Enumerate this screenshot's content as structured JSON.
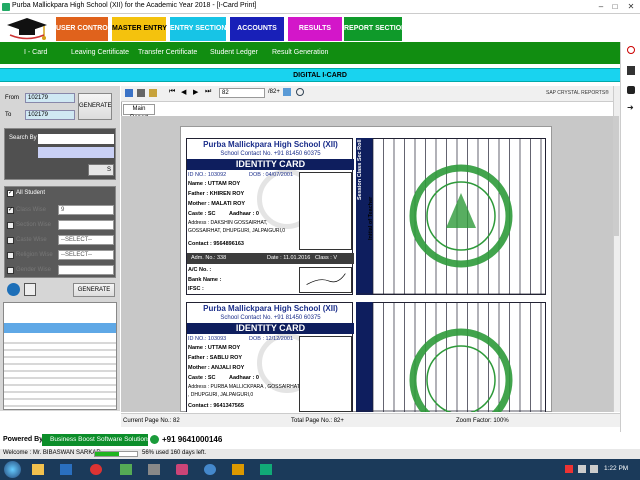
{
  "window": {
    "title": "Purba Mallickpara High School (XII) for the Academic Year 2018 - [I-Card Print]"
  },
  "menu": [
    {
      "label": "USER CONTROL",
      "color": "#e0621c",
      "text": "#fff"
    },
    {
      "label": "MASTER ENTRY",
      "color": "#f4c20d",
      "text": "#000"
    },
    {
      "label": "ENTRY SECTION",
      "color": "#17c4e6",
      "text": "#fff"
    },
    {
      "label": "ACCOUNTS",
      "color": "#1820b8",
      "text": "#fff"
    },
    {
      "label": "RESULTS",
      "color": "#d316c9",
      "text": "#fff"
    },
    {
      "label": "REPORT SECTION",
      "color": "#0f9a2a",
      "text": "#fff"
    }
  ],
  "subnav": [
    "I - Card",
    "Leaving Certificate",
    "Transfer Certificate",
    "Student Ledger",
    "Result Generation"
  ],
  "header": {
    "title": "DIGITAL I-CARD"
  },
  "left": {
    "from_label": "From",
    "from_value": "102179",
    "to_label": "To",
    "to_value": "102179",
    "generate": "GENERATE",
    "search_label": "Search By",
    "all_student": "All Student",
    "class_wise": "Class Wise",
    "class_value": "9",
    "section_wise": "Section Wise",
    "caste_wise": "Caste Wise",
    "caste_value": "--SELECT--",
    "religion_wise": "Religion Wise",
    "religion_value": "--SELECT--",
    "gender_wise": "Gender Wise",
    "generate2": "GENERATE"
  },
  "viewer": {
    "page_input": "82",
    "page_total": "/82+",
    "brand": "SAP CRYSTAL REPORTS®",
    "tab": "Main Report",
    "current_page": "Current Page No.: 82",
    "total_page": "Total Page No.: 82+",
    "zoom": "Zoom Factor: 100%"
  },
  "card1": {
    "school": "Purba Mallickpara High School (XII)",
    "contact": "School Contact No. +91 81450 60375",
    "heading": "IDENTITY CARD",
    "id_no": "ID NO.: 103092",
    "dob": "DOB : 04/07/2001",
    "name": "Name : UTTAM ROY",
    "father": "Father : KHIREN ROY",
    "mother": "Mother : MALATI ROY",
    "caste": "Caste : SC",
    "aadhaar": "Aadhaar : 0",
    "address": "Address : DAKSHIN GOSSAIRHAT,",
    "address2": "GOSSAIRHAT, DHUPGURI, JALPAIGURI,0",
    "contact_no": "Contact : 9564896163",
    "adm": "Adm. No.: 338",
    "date": "Date : 11.01.2016",
    "class": "Class : V",
    "ac": "A/C No. :",
    "bank": "Bank Name :",
    "ifsc": "IFSC :"
  },
  "card2": {
    "school": "Purba Mallickpara High School (XII)",
    "contact": "School Contact No. +91 81450 60375",
    "heading": "IDENTITY CARD",
    "id_no": "ID NO.: 103093",
    "dob": "DOB : 12/12/2001",
    "name": "Name : UTTAM ROY",
    "father": "Father : SABLU ROY",
    "mother": "Mother : ANJALI ROY",
    "caste": "Caste : SC",
    "aadhaar": "Aadhaar : 0",
    "address": "Address : PURBA MALLICKPARA , GOSSAIRHAT",
    "address2": ", DHUPGURI, JALPAIGURI,0",
    "contact_no": "Contact : 9641347565"
  },
  "back": {
    "col1": "Session Class Sec Roll",
    "col2": "Initial of Teacher"
  },
  "footer": {
    "powered": "Powered By :",
    "company": "Business Boost Software Solutions",
    "phone": "+91 9641000146",
    "welcome": "Welcome : Mr. BIBASWAN SARKAR",
    "usage": "56% used 160 days left.",
    "usage_fraction": 0.56,
    "time": "1:22 PM"
  }
}
